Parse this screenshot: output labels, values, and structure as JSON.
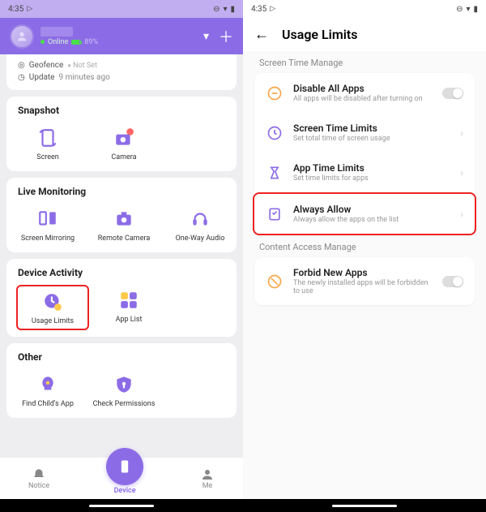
{
  "left": {
    "status": {
      "time": "4:35"
    },
    "header": {
      "online": "Online",
      "battery": "89%"
    },
    "info": {
      "geofence_label": "Geofence",
      "geofence_value": "Not Set",
      "update_label": "Update",
      "update_value": "9 minutes ago"
    },
    "sections": {
      "snapshot": {
        "title": "Snapshot",
        "items": [
          "Screen",
          "Camera"
        ]
      },
      "live": {
        "title": "Live Monitoring",
        "items": [
          "Screen Mirroring",
          "Remote Camera",
          "One-Way Audio"
        ]
      },
      "activity": {
        "title": "Device Activity",
        "items": [
          "Usage Limits",
          "App List"
        ]
      },
      "other": {
        "title": "Other",
        "items": [
          "Find Child's App",
          "Check Permissions"
        ]
      }
    },
    "nav": {
      "notice": "Notice",
      "device": "Device",
      "me": "Me"
    }
  },
  "right": {
    "status": {
      "time": "4:35"
    },
    "title": "Usage Limits",
    "section1_label": "Screen Time Manage",
    "section2_label": "Content Access Manage",
    "rows": {
      "disable": {
        "title": "Disable All Apps",
        "sub": "All apps will be disabled after turning on"
      },
      "stlimits": {
        "title": "Screen Time Limits",
        "sub": "Set total time of screen usage"
      },
      "applimits": {
        "title": "App Time Limits",
        "sub": "Set time limits for apps"
      },
      "always": {
        "title": "Always Allow",
        "sub": "Always allow the apps on the list"
      },
      "forbid": {
        "title": "Forbid New Apps",
        "sub": "The newly installed apps will be forbidden to use"
      }
    }
  }
}
